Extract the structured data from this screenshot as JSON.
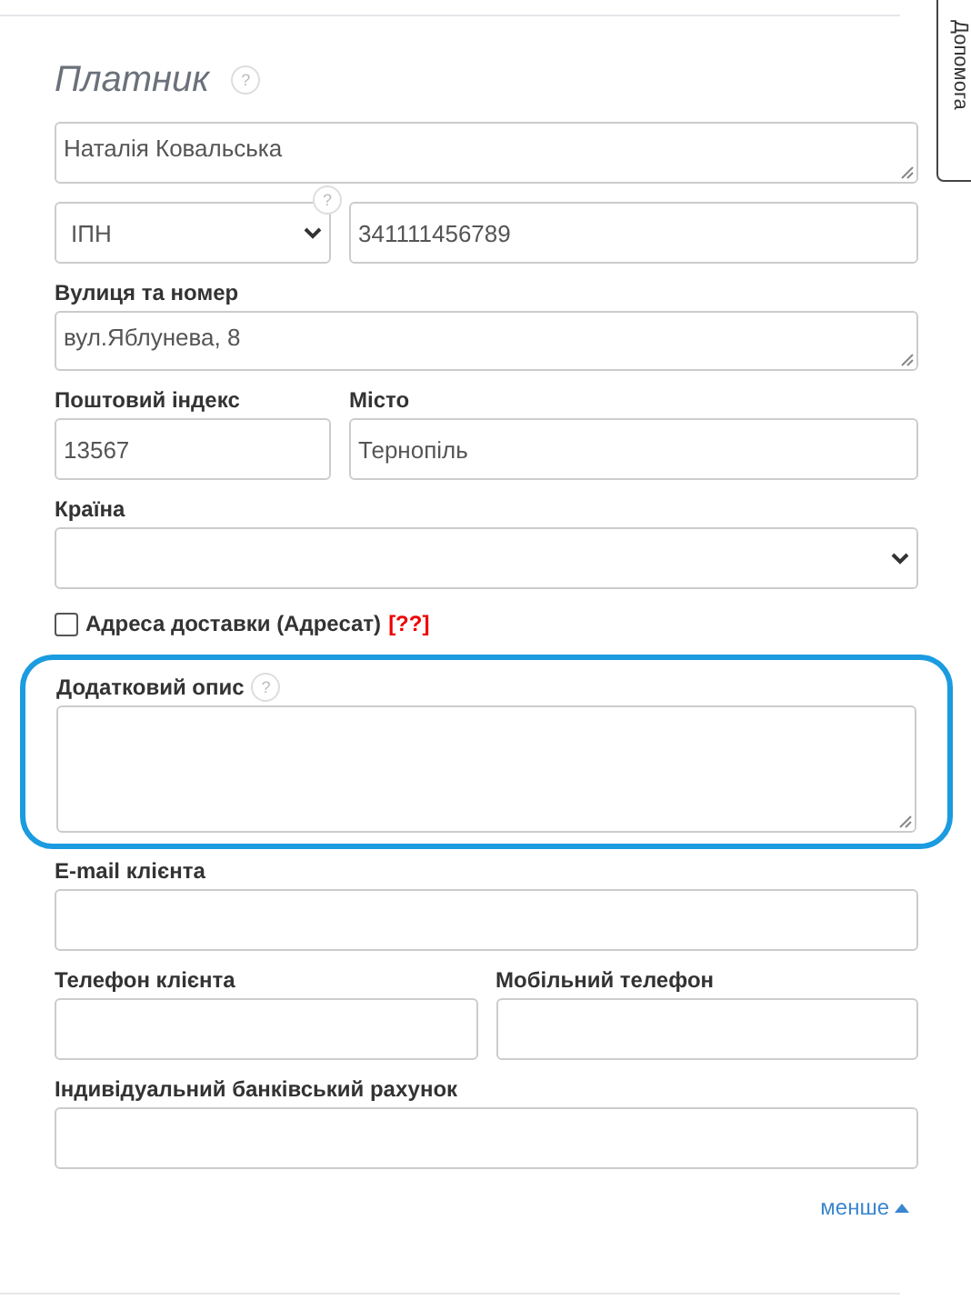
{
  "side_tab": {
    "label": "Допомога"
  },
  "section": {
    "title": "Платник",
    "help": "?"
  },
  "name_field": {
    "value": "Наталія Ковальська"
  },
  "id_type": {
    "value": "ІПН",
    "help": "?"
  },
  "id_number": {
    "value": "341111456789"
  },
  "fields": [
    {
      "kind": "textarea",
      "label": "Вулиця та номер",
      "value": "вул.Яблунева, 8"
    },
    {
      "kind": "pair",
      "items": [
        {
          "label": "Поштовий індекс",
          "value": "13567"
        },
        {
          "label": "Місто",
          "value": "Тернопіль"
        }
      ]
    },
    {
      "kind": "select",
      "label": "Країна"
    }
  ],
  "delivery": {
    "label": "Адреса доставки (Адресат)",
    "marker": "[??]",
    "checked": false
  },
  "description": {
    "label": "Додатковий опис",
    "help": "?",
    "highlighted": true
  },
  "fields2": [
    {
      "kind": "input",
      "label": "E-mail клієнта"
    },
    {
      "kind": "pair",
      "items": [
        {
          "label": "Телефон клієнта"
        },
        {
          "label": "Мобільний телефон"
        }
      ]
    },
    {
      "kind": "input",
      "label": "Індивідуальний банківський рахунок"
    }
  ],
  "less_link": {
    "label": "менше"
  }
}
